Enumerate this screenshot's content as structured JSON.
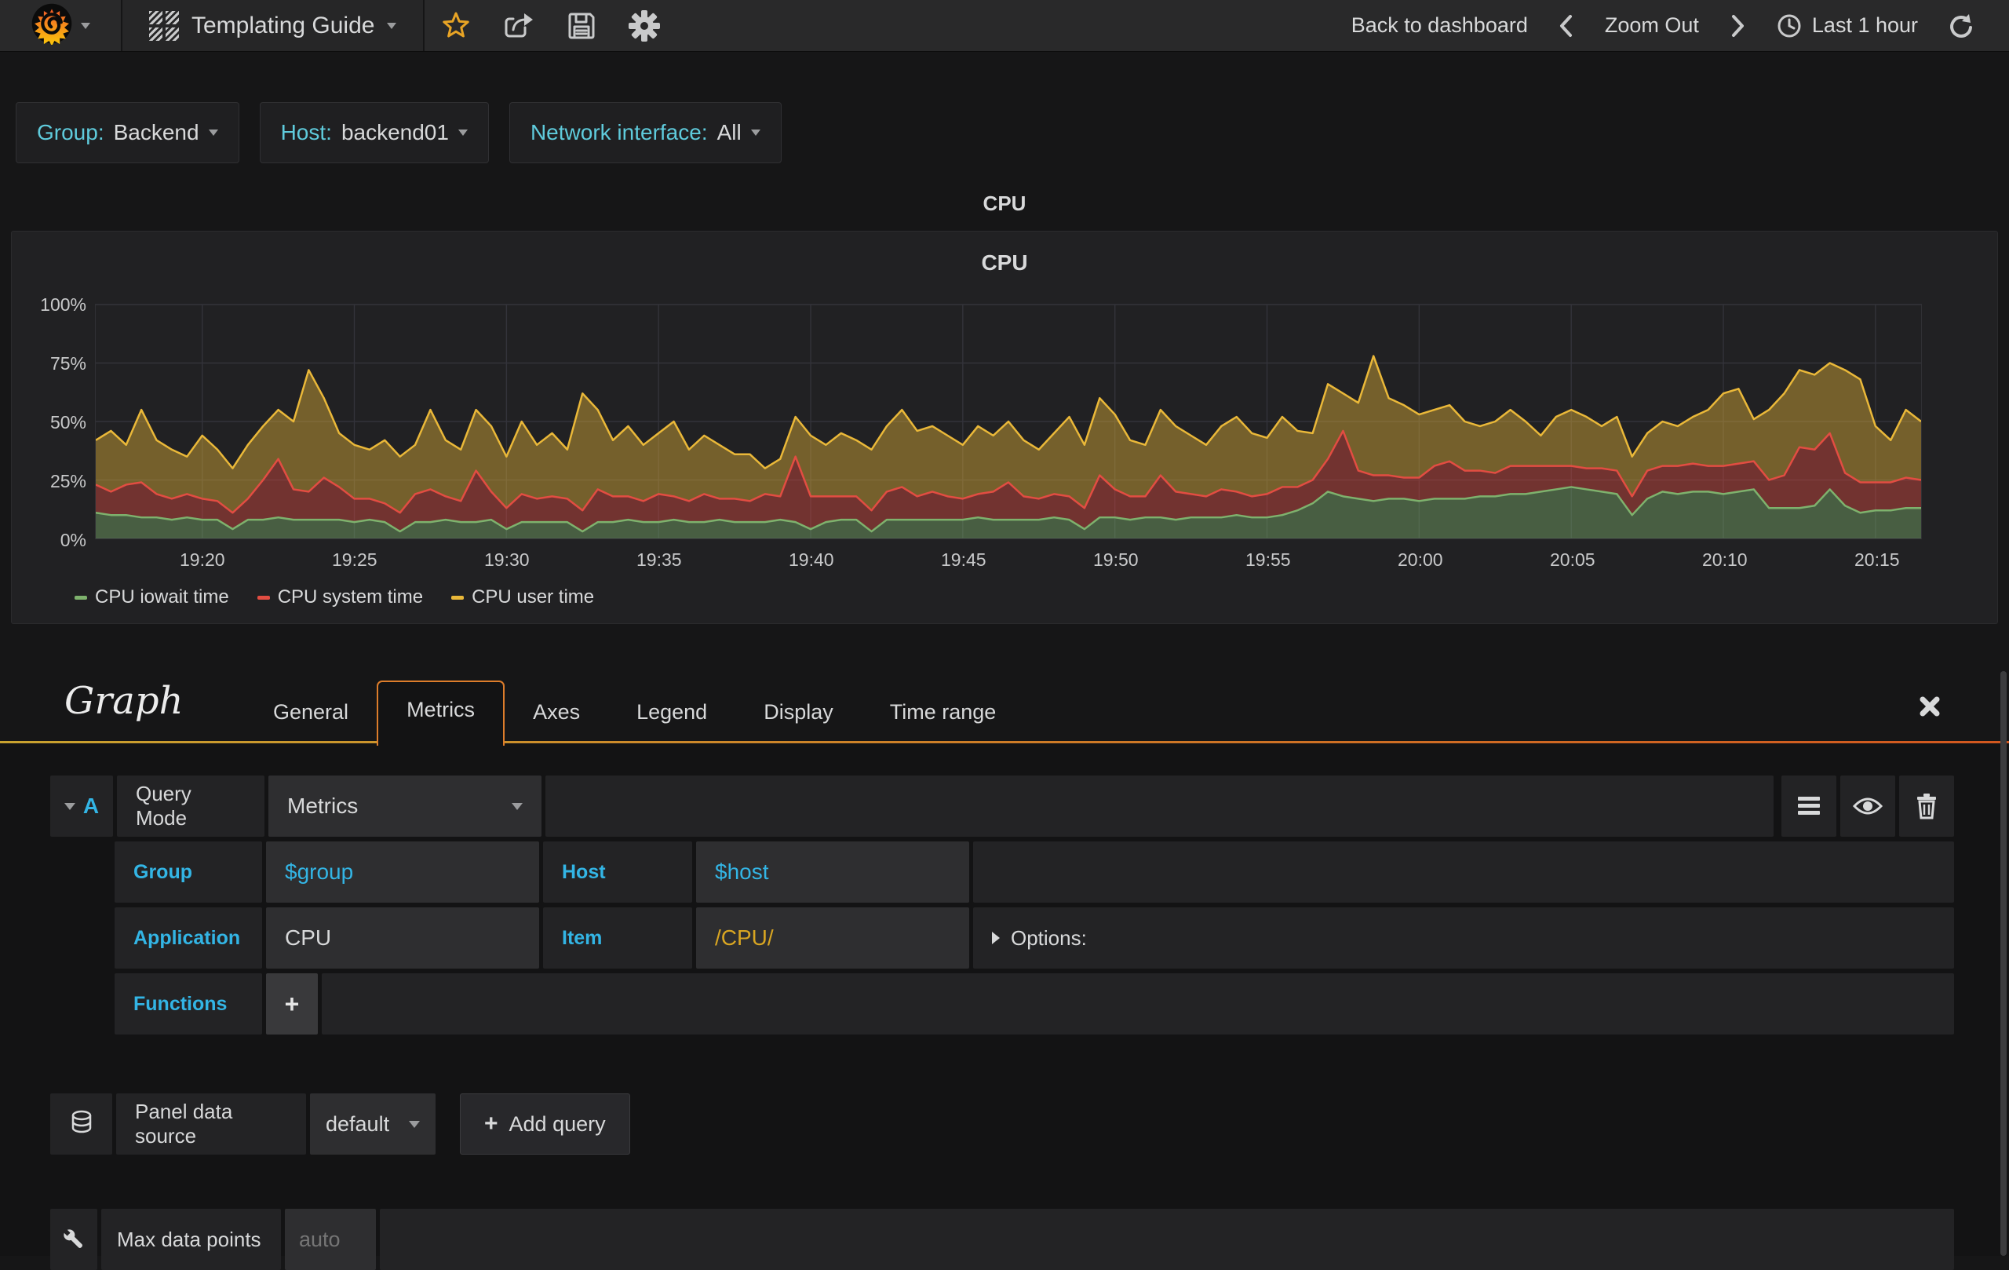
{
  "navbar": {
    "title": "Templating Guide",
    "back_to_dashboard": "Back to dashboard",
    "zoom_out": "Zoom Out",
    "time_range": "Last 1 hour"
  },
  "variables": [
    {
      "label": "Group:",
      "value": "Backend"
    },
    {
      "label": "Host:",
      "value": "backend01"
    },
    {
      "label": "Network interface:",
      "value": "All"
    }
  ],
  "panel": {
    "header_title": "CPU"
  },
  "chart_data": {
    "type": "area",
    "stacked": true,
    "title": "CPU",
    "ylabel": "",
    "xlabel": "",
    "ylim": [
      0,
      100
    ],
    "y_unit": "percent",
    "grid": true,
    "legend_position": "bottom-left",
    "y_ticks": [
      {
        "label": "0%",
        "value": 0
      },
      {
        "label": "25%",
        "value": 25
      },
      {
        "label": "50%",
        "value": 50
      },
      {
        "label": "75%",
        "value": 75
      },
      {
        "label": "100%",
        "value": 100
      }
    ],
    "x_start": "19:16:30",
    "x_end": "20:16:30",
    "duration_min": 60,
    "x_ticks": [
      {
        "label": "19:20",
        "t": 3.5
      },
      {
        "label": "19:25",
        "t": 8.5
      },
      {
        "label": "19:30",
        "t": 13.5
      },
      {
        "label": "19:35",
        "t": 18.5
      },
      {
        "label": "19:40",
        "t": 23.5
      },
      {
        "label": "19:45",
        "t": 28.5
      },
      {
        "label": "19:50",
        "t": 33.5
      },
      {
        "label": "19:55",
        "t": 38.5
      },
      {
        "label": "20:00",
        "t": 43.5
      },
      {
        "label": "20:05",
        "t": 48.5
      },
      {
        "label": "20:10",
        "t": 53.5
      },
      {
        "label": "20:15",
        "t": 58.5
      }
    ],
    "series": [
      {
        "name": "CPU iowait time",
        "color": "#7EB26D",
        "fill": "rgba(126,178,109,0.42)",
        "values": [
          11,
          10,
          10,
          9,
          9,
          8,
          9,
          8,
          8,
          4,
          8,
          8,
          9,
          8,
          8,
          8,
          8,
          7,
          8,
          7,
          3,
          7,
          7,
          8,
          7,
          7,
          8,
          4,
          7,
          7,
          7,
          7,
          3,
          7,
          7,
          8,
          7,
          7,
          8,
          7,
          7,
          8,
          7,
          7,
          7,
          8,
          7,
          4,
          7,
          8,
          8,
          3,
          8,
          8,
          8,
          8,
          8,
          8,
          9,
          8,
          8,
          8,
          8,
          9,
          8,
          4,
          9,
          9,
          8,
          9,
          9,
          8,
          9,
          9,
          9,
          10,
          9,
          9,
          10,
          12,
          15,
          20,
          18,
          17,
          16,
          17,
          17,
          16,
          17,
          17,
          17,
          18,
          18,
          19,
          19,
          20,
          21,
          22,
          21,
          20,
          19,
          10,
          17,
          20,
          19,
          20,
          20,
          19,
          20,
          21,
          13,
          13,
          13,
          14,
          21,
          14,
          11,
          12,
          12,
          13,
          13
        ]
      },
      {
        "name": "CPU system time",
        "color": "#E24D42",
        "fill": "rgba(226,77,66,0.42)",
        "values": [
          12,
          10,
          13,
          15,
          10,
          9,
          10,
          9,
          8,
          7,
          9,
          17,
          25,
          13,
          12,
          18,
          14,
          10,
          9,
          8,
          8,
          12,
          14,
          10,
          9,
          22,
          12,
          9,
          12,
          10,
          11,
          10,
          9,
          14,
          11,
          10,
          9,
          12,
          10,
          9,
          12,
          9,
          10,
          9,
          12,
          10,
          28,
          14,
          11,
          10,
          10,
          9,
          12,
          14,
          10,
          12,
          10,
          9,
          10,
          12,
          16,
          10,
          9,
          10,
          10,
          9,
          18,
          12,
          10,
          9,
          18,
          12,
          10,
          9,
          12,
          10,
          9,
          10,
          12,
          10,
          10,
          14,
          28,
          12,
          11,
          10,
          9,
          10,
          14,
          16,
          12,
          11,
          10,
          12,
          12,
          11,
          10,
          9,
          9,
          10,
          10,
          8,
          12,
          11,
          12,
          12,
          11,
          12,
          12,
          12,
          12,
          14,
          26,
          24,
          24,
          14,
          13,
          12,
          12,
          13,
          12
        ]
      },
      {
        "name": "CPU user time",
        "color": "#EAB839",
        "fill": "rgba(234,184,57,0.42)",
        "values": [
          19,
          26,
          17,
          31,
          23,
          21,
          16,
          27,
          22,
          19,
          23,
          23,
          21,
          29,
          52,
          34,
          23,
          23,
          21,
          27,
          24,
          21,
          34,
          24,
          22,
          26,
          28,
          22,
          31,
          23,
          27,
          21,
          50,
          34,
          24,
          30,
          24,
          26,
          32,
          22,
          25,
          23,
          19,
          20,
          11,
          16,
          17,
          26,
          22,
          27,
          24,
          26,
          28,
          33,
          28,
          28,
          26,
          23,
          29,
          24,
          26,
          24,
          21,
          26,
          34,
          27,
          33,
          32,
          24,
          22,
          28,
          28,
          25,
          22,
          27,
          32,
          27,
          24,
          30,
          24,
          20,
          32,
          16,
          29,
          51,
          33,
          31,
          27,
          24,
          24,
          21,
          19,
          22,
          24,
          19,
          13,
          21,
          24,
          22,
          18,
          23,
          17,
          16,
          19,
          17,
          20,
          24,
          31,
          32,
          18,
          30,
          35,
          33,
          32,
          30,
          44,
          44,
          24,
          18,
          29,
          25
        ]
      }
    ]
  },
  "editor": {
    "panel_type": "Graph",
    "tabs": [
      "General",
      "Metrics",
      "Axes",
      "Legend",
      "Display",
      "Time range"
    ],
    "query": {
      "letter": "A",
      "query_mode_label": "Query Mode",
      "query_mode_value": "Metrics",
      "group_label": "Group",
      "group_value": "$group",
      "host_label": "Host",
      "host_value": "$host",
      "application_label": "Application",
      "application_value": "CPU",
      "item_label": "Item",
      "item_value": "/CPU/",
      "options_label": "Options:",
      "functions_label": "Functions",
      "add_function_label": "+"
    },
    "datasource": {
      "label": "Panel data source",
      "value": "default",
      "add_query_label": "Add query",
      "add_query_plus": "+"
    },
    "max_data_points": {
      "label": "Max data points",
      "placeholder": "auto"
    }
  }
}
